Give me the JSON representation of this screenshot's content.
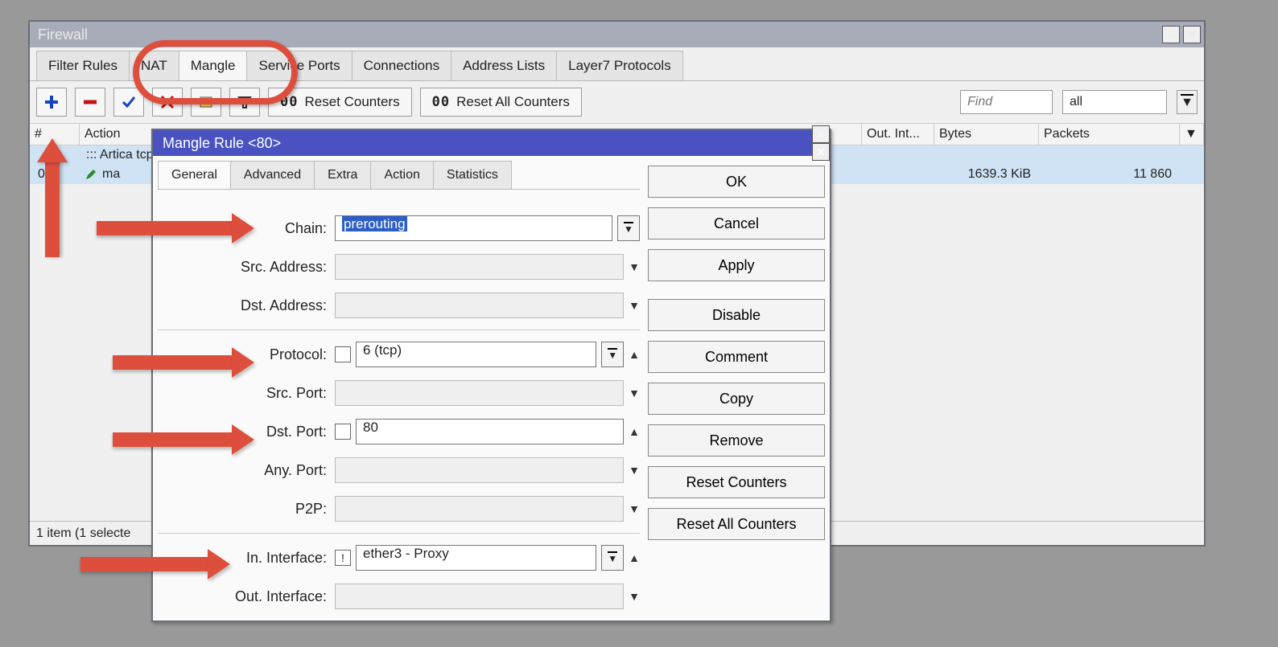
{
  "window": {
    "title": "Firewall",
    "tabs": [
      "Filter Rules",
      "NAT",
      "Mangle",
      "Service Ports",
      "Connections",
      "Address Lists",
      "Layer7 Protocols"
    ],
    "active_tab_index": 2
  },
  "toolbar": {
    "reset_counters": "Reset Counters",
    "reset_all_counters": "Reset All Counters",
    "find_placeholder": "Find",
    "filter_value": "all"
  },
  "table": {
    "headers": {
      "num": "#",
      "action": "Action",
      "out": "Out. Int...",
      "bytes": "Bytes",
      "packets": "Packets"
    },
    "comment_row": "::: Artica tcp/",
    "rows": [
      {
        "num": "0",
        "action": "ma",
        "out": "",
        "bytes": "1639.3 KiB",
        "packets": "11 860"
      }
    ]
  },
  "status": "1 item (1 selecte",
  "dialog": {
    "title": "Mangle Rule <80>",
    "tabs": [
      "General",
      "Advanced",
      "Extra",
      "Action",
      "Statistics"
    ],
    "active_tab_index": 0,
    "fields": {
      "chain": {
        "label": "Chain:",
        "value": "prerouting"
      },
      "src_address": {
        "label": "Src. Address:",
        "value": ""
      },
      "dst_address": {
        "label": "Dst. Address:",
        "value": ""
      },
      "protocol": {
        "label": "Protocol:",
        "value": "6 (tcp)"
      },
      "src_port": {
        "label": "Src. Port:",
        "value": ""
      },
      "dst_port": {
        "label": "Dst. Port:",
        "value": "80"
      },
      "any_port": {
        "label": "Any. Port:",
        "value": ""
      },
      "p2p": {
        "label": "P2P:",
        "value": ""
      },
      "in_interface": {
        "label": "In. Interface:",
        "value": "ether3 - Proxy",
        "invert": "!"
      },
      "out_interface": {
        "label": "Out. Interface:",
        "value": ""
      }
    },
    "buttons": [
      "OK",
      "Cancel",
      "Apply",
      "Disable",
      "Comment",
      "Copy",
      "Remove",
      "Reset Counters",
      "Reset All Counters"
    ]
  }
}
